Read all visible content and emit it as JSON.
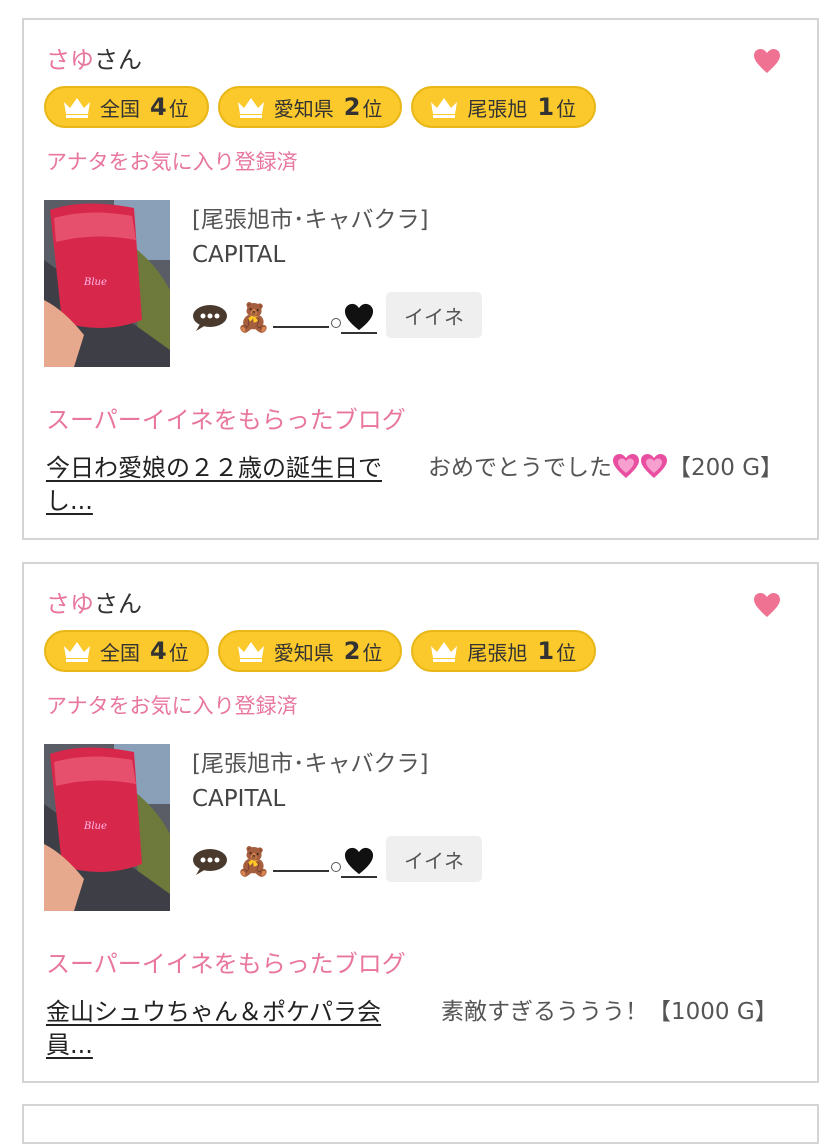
{
  "colors": {
    "accent": "#e8769f",
    "badge": "#fbc92b",
    "border": "#d4d4d4"
  },
  "cards": [
    {
      "name_prefix": "さゆ",
      "name_suffix": "さん",
      "badges": [
        {
          "region": "全国",
          "rank": "4",
          "unit": "位"
        },
        {
          "region": "愛知県",
          "rank": "2",
          "unit": "位"
        },
        {
          "region": "尾張旭",
          "rank": "1",
          "unit": "位"
        }
      ],
      "fav_status": "アナタをお気に入り登録済",
      "shop_area": "[尾張旭市･キャバクラ]",
      "shop_name": "CAPITAL",
      "comment_emoji": "🧸",
      "iine_label": "イイネ",
      "super_title": "スーパーイイネをもらったブログ",
      "blog_title": "今日わ愛娘の２２歳の誕生日でし...",
      "blog_comment": "おめでとうでした",
      "blog_reward": "【200 G】"
    },
    {
      "name_prefix": "さゆ",
      "name_suffix": "さん",
      "badges": [
        {
          "region": "全国",
          "rank": "4",
          "unit": "位"
        },
        {
          "region": "愛知県",
          "rank": "2",
          "unit": "位"
        },
        {
          "region": "尾張旭",
          "rank": "1",
          "unit": "位"
        }
      ],
      "fav_status": "アナタをお気に入り登録済",
      "shop_area": "[尾張旭市･キャバクラ]",
      "shop_name": "CAPITAL",
      "comment_emoji": "🧸",
      "iine_label": "イイネ",
      "super_title": "スーパーイイネをもらったブログ",
      "blog_title": "金山シュウちゃん＆ポケパラ会員...",
      "blog_comment": "素敵すぎるううう！【1000 G】"
    }
  ],
  "icons": {
    "heart": "heart-icon",
    "crown": "crown-icon",
    "speech": "speech-bubble-icon",
    "bear": "teddy-bear-icon",
    "black_heart": "black-heart-icon",
    "sparkle_heart": "pink-heart-icon"
  }
}
